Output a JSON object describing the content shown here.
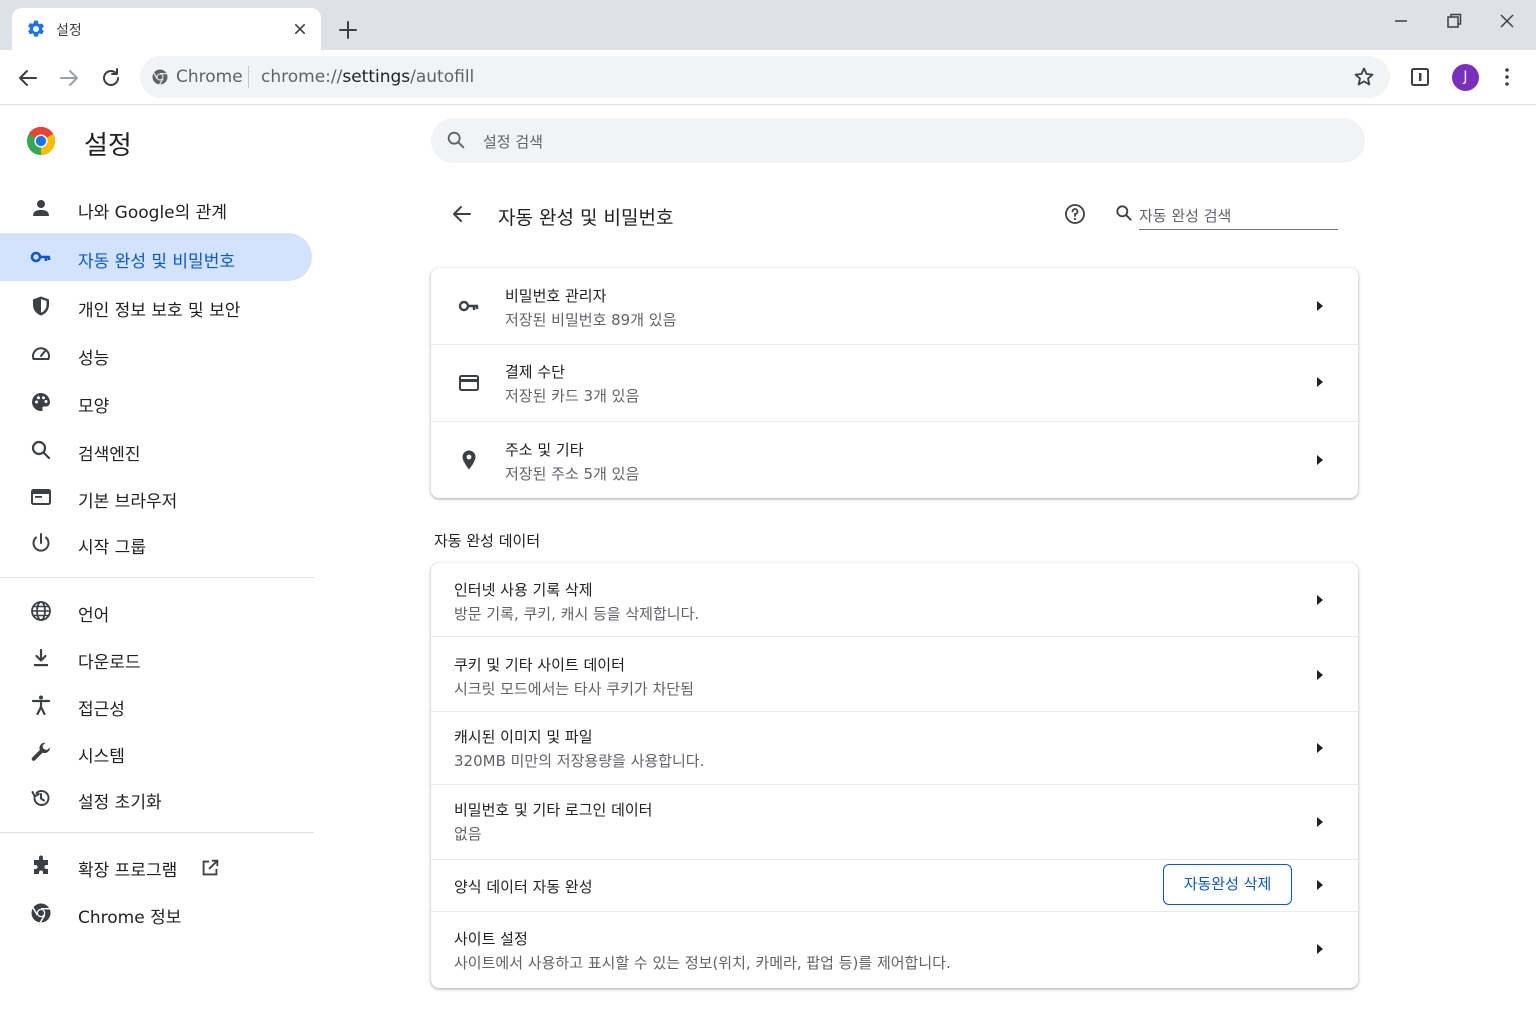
{
  "tab": {
    "title": "설정"
  },
  "toolbar": {
    "omnibox_chip": "Chrome",
    "url_scheme": "chrome://",
    "url_host": "settings",
    "url_path": "/autofill",
    "avatar_initial": "J"
  },
  "colors": {
    "accent": "#0b57d0",
    "active_nav_bg": "#d3e3fd",
    "avatar": "#7b2fbe"
  },
  "sidebar": {
    "title": "설정",
    "items": [
      {
        "label": "나와 Google의 관계",
        "icon": "person-icon"
      },
      {
        "label": "자동 완성 및 비밀번호",
        "icon": "key-icon",
        "active": true
      },
      {
        "label": "개인 정보 보호 및 보안",
        "icon": "shield-icon"
      },
      {
        "label": "성능",
        "icon": "speedometer-icon"
      },
      {
        "label": "모양",
        "icon": "palette-icon"
      },
      {
        "label": "검색엔진",
        "icon": "search-icon"
      },
      {
        "label": "기본 브라우저",
        "icon": "browser-window-icon"
      },
      {
        "label": "시작 그룹",
        "icon": "power-icon"
      },
      {
        "label": "언어",
        "icon": "globe-icon"
      },
      {
        "label": "다운로드",
        "icon": "download-icon"
      },
      {
        "label": "접근성",
        "icon": "accessibility-icon"
      },
      {
        "label": "시스템",
        "icon": "wrench-icon"
      },
      {
        "label": "설정 초기화",
        "icon": "history-icon"
      },
      {
        "label": "확장 프로그램",
        "icon": "puzzle-icon"
      },
      {
        "label": "Chrome 정보",
        "icon": "chrome-icon"
      }
    ]
  },
  "main": {
    "search_placeholder": "설정 검색",
    "page_title": "자동 완성 및 비밀번호",
    "sub_search_placeholder": "자동 완성 검색",
    "autofill_rows": [
      {
        "title": "비밀번호 관리자",
        "subtitle": "저장된 비밀번호 89개 있음",
        "icon": "key-icon"
      },
      {
        "title": "결제 수단",
        "subtitle": "저장된 카드 3개 있음",
        "icon": "credit-card-icon"
      },
      {
        "title": "주소 및 기타",
        "subtitle": "저장된 주소 5개 있음",
        "icon": "location-pin-icon"
      }
    ],
    "section_title": "자동 완성 데이터",
    "data_rows": [
      {
        "title": "인터넷 사용 기록 삭제",
        "subtitle": "방문 기록, 쿠키, 캐시 등을 삭제합니다."
      },
      {
        "title": "쿠키 및 기타 사이트 데이터",
        "subtitle": "시크릿 모드에서는 타사 쿠키가 차단됨"
      },
      {
        "title": "캐시된 이미지 및 파일",
        "subtitle": "320MB 미만의 저장용량을 사용합니다."
      },
      {
        "title": "비밀번호 및 기타 로그인 데이터",
        "subtitle": "없음"
      },
      {
        "title": "양식 데이터 자동 완성",
        "button": "자동완성 삭제"
      },
      {
        "title": "사이트 설정",
        "subtitle": "사이트에서 사용하고 표시할 수 있는 정보(위치, 카메라, 팝업 등)를 제어합니다."
      }
    ]
  }
}
